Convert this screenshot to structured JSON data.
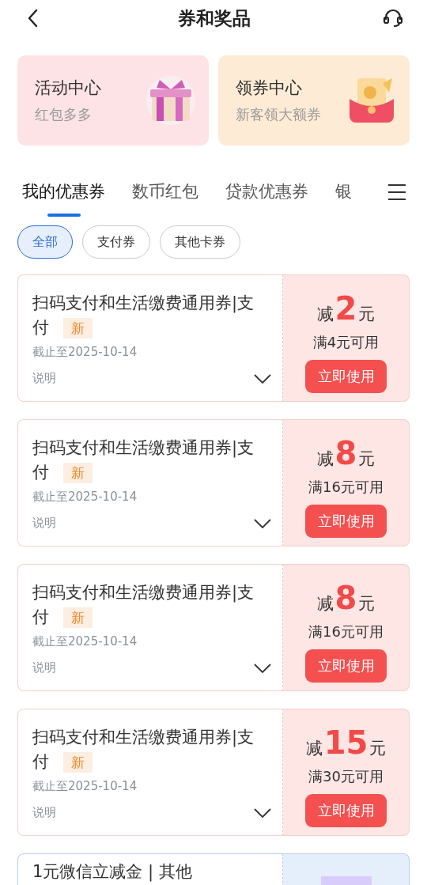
{
  "header": {
    "title": "券和奖品"
  },
  "promos": [
    {
      "kind": "gift",
      "title": "活动中心",
      "subtitle": "红包多多"
    },
    {
      "kind": "envelope",
      "title": "领券中心",
      "subtitle": "新客领大额券"
    }
  ],
  "tabs": [
    {
      "label": "我的优惠券",
      "selected": true
    },
    {
      "label": "数币红包",
      "selected": false
    },
    {
      "label": "贷款优惠券",
      "selected": false
    },
    {
      "label": "银",
      "selected": false
    }
  ],
  "filters": [
    {
      "label": "全部",
      "selected": true
    },
    {
      "label": "支付券",
      "selected": false
    },
    {
      "label": "其他卡券",
      "selected": false
    }
  ],
  "coupons": [
    {
      "kind": "discount",
      "title": "扫码支付和生活缴费通用券|支付",
      "tag": "新",
      "expiry": "截止至2025-10-14",
      "note": "说明",
      "prefix": "减",
      "amount": "2",
      "unit": "元",
      "condition": "满4元可用",
      "button": "立即使用"
    },
    {
      "kind": "discount",
      "title": "扫码支付和生活缴费通用券|支付",
      "tag": "新",
      "expiry": "截止至2025-10-14",
      "note": "说明",
      "prefix": "减",
      "amount": "8",
      "unit": "元",
      "condition": "满16元可用",
      "button": "立即使用"
    },
    {
      "kind": "discount",
      "title": "扫码支付和生活缴费通用券|支付",
      "tag": "新",
      "expiry": "截止至2025-10-14",
      "note": "说明",
      "prefix": "减",
      "amount": "8",
      "unit": "元",
      "condition": "满16元可用",
      "button": "立即使用"
    },
    {
      "kind": "discount",
      "title": "扫码支付和生活缴费通用券|支付",
      "tag": "新",
      "expiry": "截止至2025-10-14",
      "note": "说明",
      "prefix": "减",
      "amount": "15",
      "unit": "元",
      "condition": "满30元可用",
      "button": "立即使用"
    },
    {
      "kind": "voucher",
      "title": "1元微信立减金 | 其他"
    }
  ]
}
